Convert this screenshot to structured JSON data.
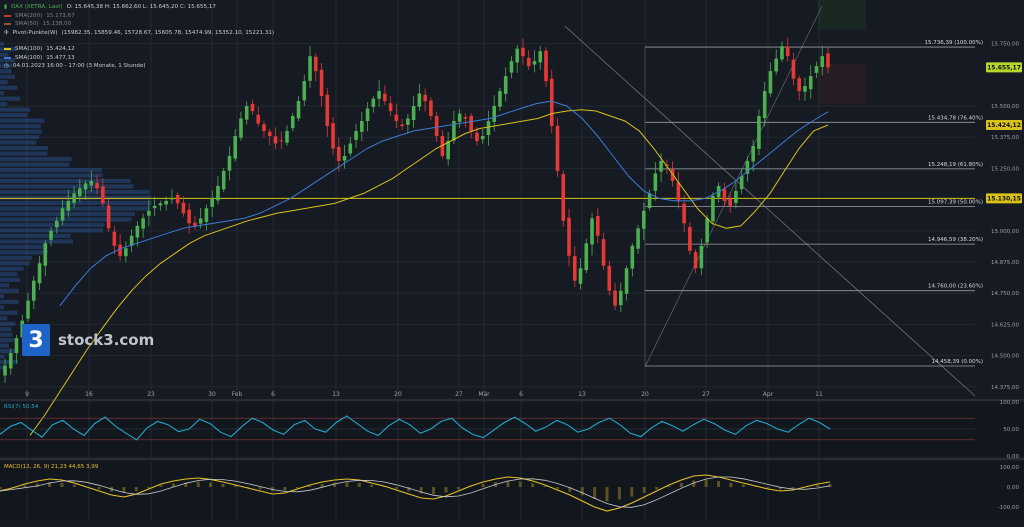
{
  "header": {
    "instrument": "DAX (XETRA, Last)",
    "ohlc": "O: 15.645,38  H: 15.662,60  L: 15.645,20  C: 15.655,17",
    "sma200_label": "SMA(200)",
    "sma200_value": "15.173,67",
    "sma50_label": "SMA(50)",
    "sma50_value": "15.138,00",
    "pivot_label": "Pivot-Punkte(W)",
    "pivot_values": "(15982.35, 15859.46, 15728.67, 15605.78, 15474.99, 15352.10, 15221.31)",
    "sma100y_label": "SMA(100)",
    "sma100y_value": "15.424,12",
    "sma100b_label": "SMA(100)",
    "sma100b_value": "15.477,13",
    "period": "04.01.2023 16:00 - 17:00   (3 Monate, 1 Stunde)"
  },
  "logo": {
    "mark": "3",
    "text": "stock3.com"
  },
  "colors": {
    "background": "#161a22",
    "up": "#4caf50",
    "down": "#e53935",
    "sma_yellow": "#d9c21a",
    "sma_blue": "#3d7bd9",
    "fib": "#9aa0a8",
    "rsi": "#23a6c9",
    "macd": "#e6c229",
    "price_tag": "#d9c21a",
    "current_tag": "#b6d92a"
  },
  "price_tags": {
    "current": "15.655,17",
    "sma_yellow": "15.424,12",
    "level": "15.130,15"
  },
  "chart_data": [
    {
      "type": "candlestick",
      "title": "",
      "x_ticks": [
        "9",
        "16",
        "23",
        "30",
        "Feb",
        "6",
        "13",
        "20",
        "27",
        "Mär",
        "6",
        "13",
        "20",
        "27",
        "Apr",
        "11"
      ],
      "y_ticks": [
        "15.750,00",
        "15.500,00",
        "15.375,00",
        "15.250,00",
        "15.000,00",
        "14.875,00",
        "14.750,00",
        "14.625,00",
        "14.500,00",
        "14.375,00"
      ],
      "ylim": [
        14330,
        15925
      ],
      "closes": [
        14460,
        14510,
        14570,
        14640,
        14720,
        14800,
        14870,
        14950,
        15000,
        15040,
        15090,
        15120,
        15150,
        15170,
        15190,
        15200,
        15170,
        15110,
        15010,
        14940,
        14900,
        14930,
        14980,
        15020,
        15050,
        15080,
        15100,
        15110,
        15120,
        15130,
        15110,
        15070,
        15030,
        15020,
        15050,
        15090,
        15130,
        15180,
        15240,
        15300,
        15380,
        15450,
        15500,
        15480,
        15430,
        15400,
        15380,
        15350,
        15360,
        15400,
        15460,
        15520,
        15600,
        15700,
        15640,
        15540,
        15420,
        15330,
        15280,
        15300,
        15350,
        15400,
        15440,
        15490,
        15530,
        15560,
        15520,
        15480,
        15440,
        15420,
        15450,
        15500,
        15550,
        15520,
        15460,
        15380,
        15300,
        15360,
        15440,
        15470,
        15450,
        15400,
        15360,
        15380,
        15440,
        15500,
        15560,
        15620,
        15680,
        15730,
        15700,
        15660,
        15680,
        15720,
        15600,
        15420,
        15240,
        15040,
        14900,
        14800,
        14850,
        14950,
        15050,
        14980,
        14860,
        14760,
        14700,
        14760,
        14850,
        14940,
        15010,
        15080,
        15150,
        15230,
        15280,
        15260,
        15200,
        15120,
        15030,
        14920,
        14850,
        14940,
        15050,
        15140,
        15180,
        15120,
        15100,
        15160,
        15220,
        15280,
        15340,
        15460,
        15560,
        15640,
        15690,
        15740,
        15700,
        15610,
        15560,
        15580,
        15620,
        15660,
        15700,
        15655
      ],
      "sma_yellow": [
        14180,
        14260,
        14350,
        14440,
        14530,
        14610,
        14690,
        14760,
        14820,
        14870,
        14910,
        14950,
        14980,
        15000,
        15020,
        15040,
        15055,
        15070,
        15080,
        15090,
        15100,
        15110,
        15130,
        15150,
        15180,
        15210,
        15250,
        15290,
        15330,
        15360,
        15390,
        15410,
        15420,
        15430,
        15440,
        15450,
        15470,
        15480,
        15485,
        15480,
        15460,
        15440,
        15400,
        15330,
        15250,
        15170,
        15090,
        15030,
        15010,
        15020,
        15080,
        15150,
        15240,
        15330,
        15400,
        15424
      ],
      "sma_blue": [
        14700,
        14780,
        14850,
        14900,
        14930,
        14950,
        14970,
        14990,
        15010,
        15020,
        15030,
        15040,
        15050,
        15070,
        15100,
        15130,
        15170,
        15210,
        15250,
        15290,
        15330,
        15360,
        15380,
        15400,
        15410,
        15420,
        15430,
        15440,
        15450,
        15470,
        15490,
        15510,
        15520,
        15500,
        15450,
        15380,
        15300,
        15220,
        15160,
        15130,
        15120,
        15120,
        15130,
        15160,
        15200,
        15250,
        15300,
        15350,
        15400,
        15440,
        15477
      ],
      "volume_profile_note": "horizontal volume-by-price histogram at left edge",
      "fib_levels": [
        {
          "price": 15736.39,
          "label": "15.736,39 (100.00%)"
        },
        {
          "price": 15434.78,
          "label": "15.434,78 (76.40%)"
        },
        {
          "price": 15248.19,
          "label": "15.248,19 (61.80%)"
        },
        {
          "price": 15097.39,
          "label": "15.097,39 (50.00%)"
        },
        {
          "price": 14946.59,
          "label": "14.946,59 (38.20%)"
        },
        {
          "price": 14760.0,
          "label": "14.760,00 (23.60%)"
        },
        {
          "price": 14458.39,
          "label": "14.458,39 (0.00%)"
        }
      ],
      "horizontal_line": 15130.15
    },
    {
      "type": "line",
      "title": "RSI(7)",
      "legend": "RSI(7)  50,54",
      "y_ticks": [
        "100,00",
        "50,00",
        "0,00"
      ],
      "ylim": [
        0,
        100
      ],
      "values": [
        40,
        55,
        62,
        48,
        35,
        58,
        66,
        50,
        38,
        60,
        72,
        55,
        42,
        30,
        52,
        64,
        58,
        45,
        50,
        68,
        60,
        44,
        36,
        54,
        70,
        62,
        48,
        40,
        58,
        66,
        50,
        44,
        62,
        74,
        60,
        46,
        38,
        56,
        68,
        58,
        42,
        50,
        64,
        70,
        52,
        40,
        34,
        48,
        62,
        72,
        60,
        46,
        54,
        66,
        58,
        44,
        50,
        62,
        70,
        58,
        42,
        36,
        52,
        64,
        56,
        46,
        58,
        68,
        60,
        48,
        40,
        56,
        66,
        60,
        50,
        44,
        58,
        70,
        62,
        50
      ]
    },
    {
      "type": "line",
      "title": "MACD",
      "legend": "MACD(12, 26, 9)  21,23  44,65  3,99",
      "y_ticks": [
        "100,00",
        "0,00",
        "-100,00"
      ],
      "ylim": [
        -170,
        130
      ],
      "values": [
        -20,
        -5,
        15,
        30,
        40,
        35,
        20,
        0,
        -20,
        -40,
        -50,
        -35,
        -10,
        15,
        30,
        40,
        45,
        38,
        25,
        10,
        -5,
        -20,
        -35,
        -30,
        -10,
        10,
        25,
        35,
        40,
        35,
        20,
        5,
        -15,
        -35,
        -55,
        -60,
        -45,
        -20,
        5,
        25,
        40,
        50,
        45,
        30,
        10,
        -15,
        -40,
        -70,
        -100,
        -120,
        -105,
        -80,
        -50,
        -20,
        10,
        35,
        55,
        60,
        50,
        35,
        20,
        5,
        -10,
        -20,
        -15,
        0,
        15,
        25
      ]
    }
  ]
}
